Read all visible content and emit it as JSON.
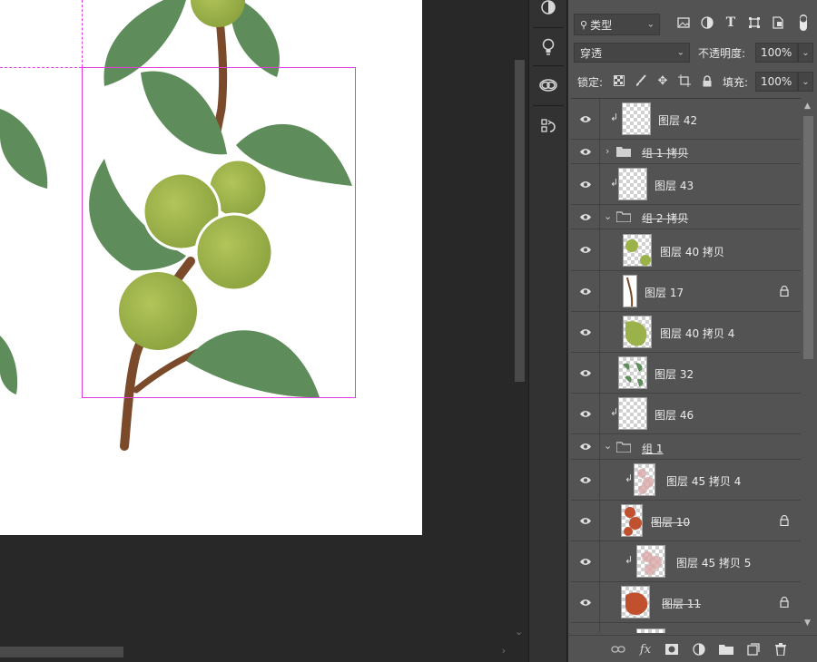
{
  "filter": {
    "kind_label": "类型"
  },
  "blend": {
    "mode": "穿透",
    "opacity_label": "不透明度:",
    "opacity_value": "100%"
  },
  "lock": {
    "label": "锁定:",
    "fill_label": "填充:",
    "fill_value": "100%"
  },
  "layers": [
    {
      "name": "图层 42",
      "type": "layer",
      "clipped": true,
      "thumb": "empty"
    },
    {
      "name": "组 1 拷贝",
      "type": "group",
      "expanded": false,
      "strike": true
    },
    {
      "name": "图层 43",
      "type": "layer",
      "clipped": true,
      "thumb": "empty"
    },
    {
      "name": "组 2 拷贝",
      "type": "group",
      "expanded": true,
      "strike": true
    },
    {
      "name": "图层 40 拷贝",
      "type": "layer",
      "clipped": false,
      "thumb": "green-fruits",
      "indent": true
    },
    {
      "name": "图层 17",
      "type": "layer",
      "clipped": false,
      "thumb": "stem",
      "indent": true,
      "locked": true
    },
    {
      "name": "图层 40 拷贝 4",
      "type": "layer",
      "clipped": false,
      "thumb": "green-blob",
      "indent": true
    },
    {
      "name": "图层 32",
      "type": "layer",
      "clipped": false,
      "thumb": "leaves",
      "indent": true
    },
    {
      "name": "图层 46",
      "type": "layer",
      "clipped": true,
      "thumb": "empty"
    },
    {
      "name": "组 1",
      "type": "group",
      "expanded": true,
      "underline": true
    },
    {
      "name": "图层 45 拷贝 4",
      "type": "layer",
      "clipped": true,
      "thumb": "pink-texture",
      "indent": true
    },
    {
      "name": "图层 10",
      "type": "layer",
      "clipped": false,
      "thumb": "red-dots",
      "indent": true,
      "locked": true,
      "strike": true
    },
    {
      "name": "图层 45 拷贝 5",
      "type": "layer",
      "clipped": true,
      "thumb": "pink-texture",
      "indent": true
    },
    {
      "name": "图层 11",
      "type": "layer",
      "clipped": false,
      "thumb": "red-blob",
      "indent": true,
      "locked": true,
      "strike": true
    }
  ],
  "colors": {
    "panel": "#535353",
    "canvas_bg": "#282828",
    "selection": "#e23de2",
    "leaf": "#5e8c5b",
    "fruit": "#9bb24a",
    "stem": "#7a4a2a"
  }
}
